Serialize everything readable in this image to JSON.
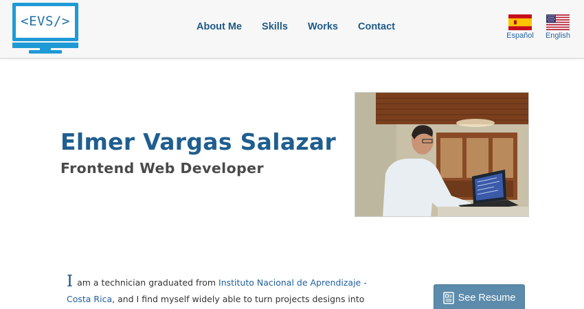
{
  "header": {
    "logo_text": "<EVS/>",
    "nav": [
      {
        "label": "About Me"
      },
      {
        "label": "Skills"
      },
      {
        "label": "Works"
      },
      {
        "label": "Contact"
      }
    ],
    "languages": [
      {
        "label": "Español",
        "icon": "spain-flag-icon"
      },
      {
        "label": "English",
        "icon": "usa-flag-icon"
      }
    ]
  },
  "hero": {
    "name": "Elmer Vargas Salazar",
    "role": "Frontend Web Developer",
    "photo": "developer-at-laptop-photo"
  },
  "about": {
    "dropcap": "I",
    "text_before": " am a technician graduated from ",
    "institution": "Instituto Nacional de Aprendizaje - Costa Rica",
    "text_after": ", and I find myself widely able to turn projects designs into aesthetic and"
  },
  "resume_button": {
    "label": "See Resume",
    "icon": "resume-icon"
  },
  "colors": {
    "brand_blue": "#1e9ad6",
    "heading_blue": "#1f5e8f",
    "nav_blue": "#1e5a87",
    "button": "#5c8bab"
  }
}
